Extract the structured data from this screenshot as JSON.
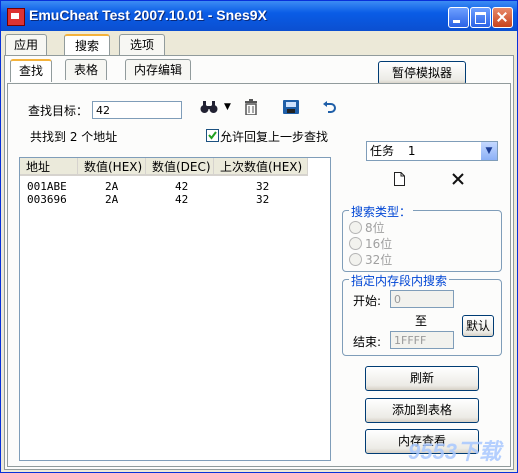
{
  "window": {
    "title": "EmuCheat Test 2007.10.01 - Snes9X"
  },
  "main_tabs": [
    "应用",
    "搜索",
    "选项"
  ],
  "sub_tabs": [
    "查找",
    "表格",
    "内存编辑"
  ],
  "pause_button": "暂停模拟器",
  "search": {
    "target_label": "查找目标：",
    "target_value": "42",
    "found_text": "共找到 2 个地址",
    "allow_undo_label": "允许回复上一步查找",
    "allow_undo_checked": true
  },
  "toolbar_icons": [
    "binoculars-icon",
    "dropdown-arrow-icon",
    "trash-icon",
    "save-disk-icon",
    "undo-arrow-icon"
  ],
  "results": {
    "columns": [
      "地址",
      "数值(HEX)",
      "数值(DEC)",
      "上次数值(HEX)"
    ],
    "rows": [
      [
        "001ABE",
        "2A",
        "42",
        "32"
      ],
      [
        "003696",
        "2A",
        "42",
        "32"
      ]
    ]
  },
  "task": {
    "label": "任务",
    "value": "1"
  },
  "search_type": {
    "title": "搜索类型：",
    "options": [
      "8位",
      "16位",
      "32位"
    ]
  },
  "mem_range": {
    "title": "指定内存段内搜索",
    "start_label": "开始:",
    "start_value": "0",
    "to_label": "至",
    "end_label": "结束:",
    "end_value": "1FFFF",
    "default_button": "默认"
  },
  "buttons": {
    "refresh": "刷新",
    "add_to_table": "添加到表格",
    "mem_view": "内存查看"
  },
  "watermark": "9553下载"
}
